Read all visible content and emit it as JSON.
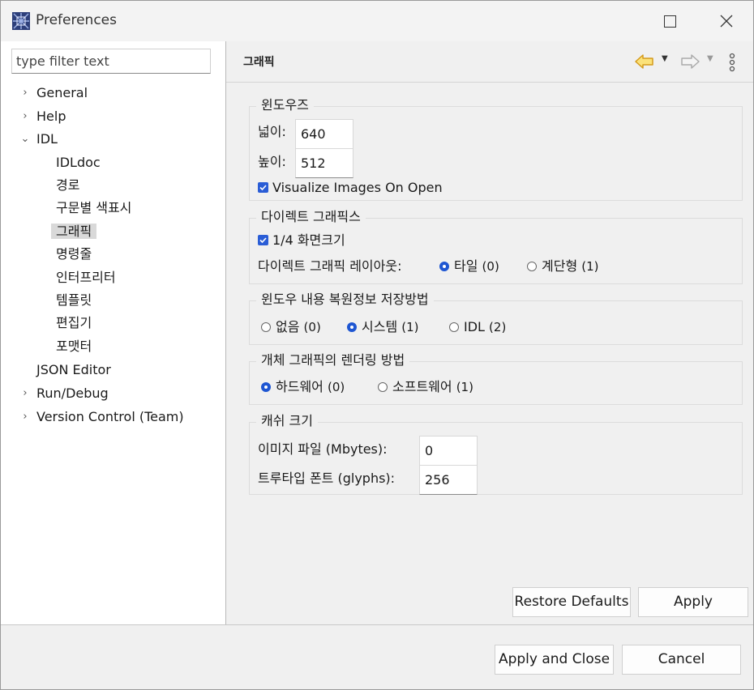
{
  "window": {
    "title": "Preferences"
  },
  "filter": {
    "placeholder": "type filter text"
  },
  "tree": {
    "items": [
      {
        "label": "General",
        "arrow": "›"
      },
      {
        "label": "Help",
        "arrow": "›"
      },
      {
        "label": "IDL",
        "arrow": "⌄"
      },
      {
        "label": "IDLdoc"
      },
      {
        "label": "경로"
      },
      {
        "label": "구문별 색표시"
      },
      {
        "label": "그래픽"
      },
      {
        "label": "명령줄"
      },
      {
        "label": "인터프리터"
      },
      {
        "label": "템플릿"
      },
      {
        "label": "편집기"
      },
      {
        "label": "포맷터"
      },
      {
        "label": "JSON Editor"
      },
      {
        "label": "Run/Debug",
        "arrow": "›"
      },
      {
        "label": "Version Control (Team)",
        "arrow": "›"
      }
    ]
  },
  "page": {
    "title": "그래픽",
    "windows": {
      "title": "윈도우즈",
      "width_label": "넓이:",
      "width_value": "640",
      "height_label": "높이:",
      "height_value": "512",
      "visualize_label": "Visualize Images On Open"
    },
    "direct": {
      "title": "다이렉트 그래픽스",
      "quarter_label": "1/4 화면크기",
      "layout_label": "다이렉트 그래픽 레이아웃:",
      "opt_tile": "타일",
      "opt_tile_num": "(0)",
      "opt_cascade": "계단형",
      "opt_cascade_num": "(1)"
    },
    "backing": {
      "title": "윈도우 내용 복원정보 저장방법",
      "opt_none": "없음",
      "opt_none_num": "(0)",
      "opt_system": "시스템",
      "opt_system_num": "(1)",
      "opt_idl": "IDL",
      "opt_idl_num": "(2)"
    },
    "render": {
      "title": "개체 그래픽의 렌더링 방법",
      "opt_hw": "하드웨어",
      "opt_hw_num": "(0)",
      "opt_sw": "소프트웨어",
      "opt_sw_num": "(1)"
    },
    "cache": {
      "title": "캐쉬 크기",
      "image_label": "이미지 파일 (Mbytes):",
      "image_value": "0",
      "font_label": "트루타입 폰트 (glyphs):",
      "font_value": "256"
    }
  },
  "buttons": {
    "restore": "Restore Defaults",
    "apply": "Apply",
    "apply_close": "Apply and Close",
    "cancel": "Cancel"
  }
}
